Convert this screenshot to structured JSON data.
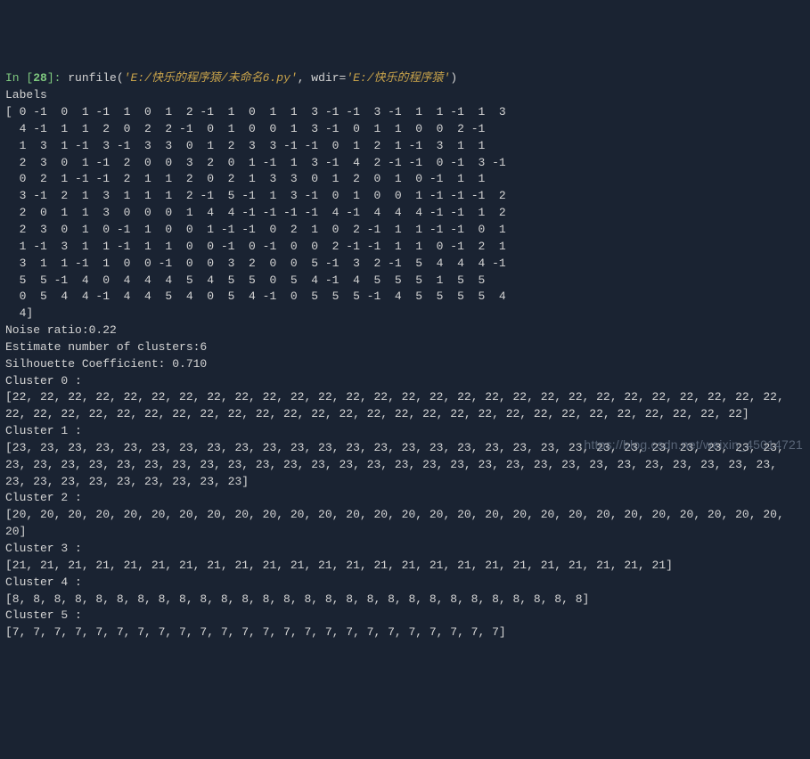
{
  "prompt": {
    "in": "In [",
    "num": "28",
    "close": "]:"
  },
  "command": {
    "func": "runfile(",
    "arg1": "'E:/快乐的程序猿/未命名6.py'",
    "comma": ", ",
    "kw": "wdir=",
    "arg2": "'E:/快乐的程序猿'",
    "end": ")"
  },
  "output": {
    "labels_header": "Labels",
    "labels_rows": [
      "[ 0 -1  0  1 -1  1  0  1  2 -1  1  0  1  1  3 -1 -1  3 -1  1  1 -1  1  3",
      "  4 -1  1  1  2  0  2  2 -1  0  1  0  0  1  3 -1  0  1  1  0  0  2 -1",
      "  1  3  1 -1  3 -1  3  3  0  1  2  3  3 -1 -1  0  1  2  1 -1  3  1  1",
      "  2  3  0  1 -1  2  0  0  3  2  0  1 -1  1  3 -1  4  2 -1 -1  0 -1  3 -1",
      "  0  2  1 -1 -1  2  1  1  2  0  2  1  3  3  0  1  2  0  1  0 -1  1  1",
      "  3 -1  2  1  3  1  1  1  2 -1  5 -1  1  3 -1  0  1  0  0  1 -1 -1 -1  2",
      "  2  0  1  1  3  0  0  0  1  4  4 -1 -1 -1 -1  4 -1  4  4  4 -1 -1  1  2",
      "  2  3  0  1  0 -1  1  0  0  1 -1 -1  0  2  1  0  2 -1  1  1 -1 -1  0  1",
      "  1 -1  3  1  1 -1  1  1  0  0 -1  0 -1  0  0  2 -1 -1  1  1  0 -1  2  1",
      "  3  1  1 -1  1  0  0 -1  0  0  3  2  0  0  5 -1  3  2 -1  5  4  4  4 -1",
      "  5  5 -1  4  0  4  4  4  5  4  5  5  0  5  4 -1  4  5  5  5  1  5  5",
      "  0  5  4  4 -1  4  4  5  4  0  5  4 -1  0  5  5  5 -1  4  5  5  5  5  4",
      "  4]"
    ],
    "noise_ratio": "Noise ratio:0.22",
    "est_clusters": "Estimate number of clusters:6",
    "silhouette": "Silhouette Coefficient: 0.710",
    "clusters": [
      {
        "label": "Cluster 0 :",
        "content": "[22, 22, 22, 22, 22, 22, 22, 22, 22, 22, 22, 22, 22, 22, 22, 22, 22, 22, 22, 22, 22, 22, 22, 22, 22, 22, 22, 22, 22, 22, 22, 22, 22, 22, 22, 22, 22, 22, 22, 22, 22, 22, 22, 22, 22, 22, 22, 22, 22, 22, 22, 22, 22, 22, 22]"
      },
      {
        "label": "Cluster 1 :",
        "content": "[23, 23, 23, 23, 23, 23, 23, 23, 23, 23, 23, 23, 23, 23, 23, 23, 23, 23, 23, 23, 23, 23, 23, 23, 23, 23, 23, 23, 23, 23, 23, 23, 23, 23, 23, 23, 23, 23, 23, 23, 23, 23, 23, 23, 23, 23, 23, 23, 23, 23, 23, 23, 23, 23, 23, 23, 23, 23, 23, 23, 23, 23, 23, 23, 23]"
      },
      {
        "label": "Cluster 2 :",
        "content": "[20, 20, 20, 20, 20, 20, 20, 20, 20, 20, 20, 20, 20, 20, 20, 20, 20, 20, 20, 20, 20, 20, 20, 20, 20, 20, 20, 20, 20]"
      },
      {
        "label": "Cluster 3 :",
        "content": "[21, 21, 21, 21, 21, 21, 21, 21, 21, 21, 21, 21, 21, 21, 21, 21, 21, 21, 21, 21, 21, 21, 21, 21]"
      },
      {
        "label": "Cluster 4 :",
        "content": "[8, 8, 8, 8, 8, 8, 8, 8, 8, 8, 8, 8, 8, 8, 8, 8, 8, 8, 8, 8, 8, 8, 8, 8, 8, 8, 8, 8]"
      },
      {
        "label": "Cluster 5 :",
        "content": "[7, 7, 7, 7, 7, 7, 7, 7, 7, 7, 7, 7, 7, 7, 7, 7, 7, 7, 7, 7, 7, 7, 7, 7]"
      }
    ]
  },
  "watermark": "https://blog.csdn.net/weixin_45014721"
}
